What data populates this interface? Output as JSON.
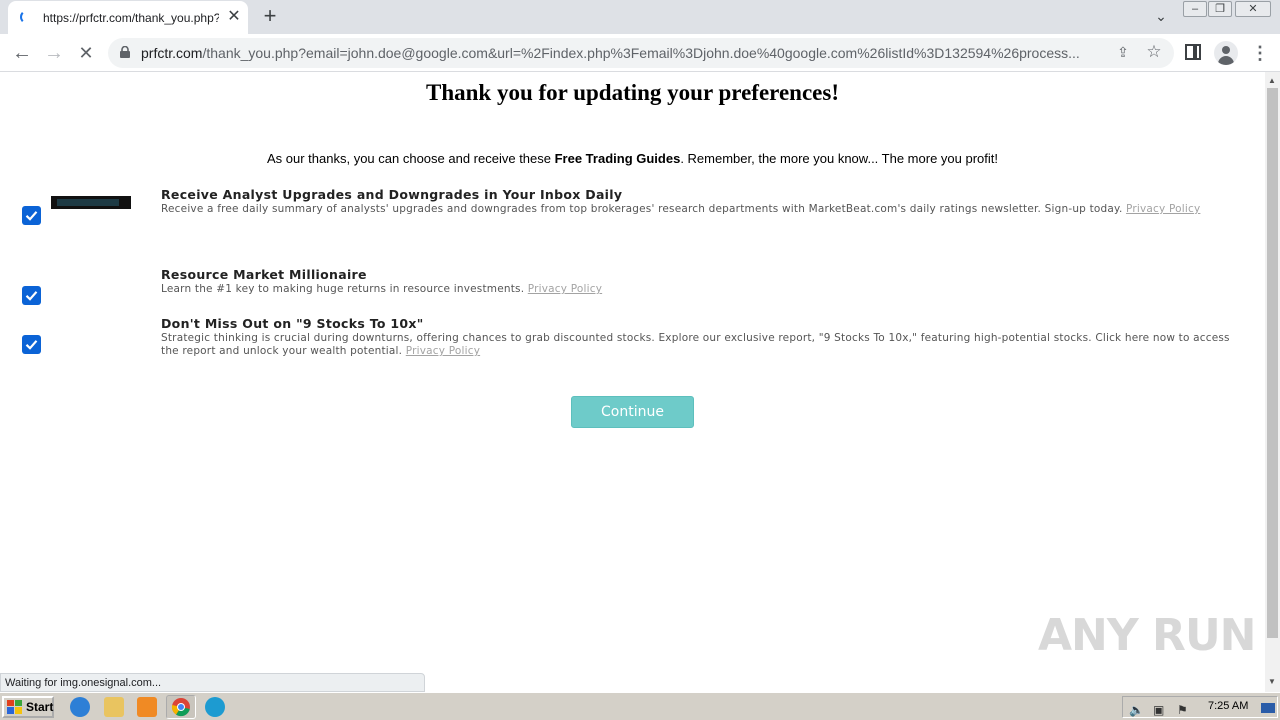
{
  "browser": {
    "tab_title": "https://prfctr.com/thank_you.php?e",
    "tab_close": "✕",
    "new_tab": "+",
    "tab_search_icon": "chevron-down-icon",
    "window_min": "‒",
    "window_max": "❐",
    "window_close": "✕",
    "url_host": "prfctr.com",
    "url_rest": "/thank_you.php?email=john.doe@google.com&url=%2Findex.php%3Femail%3Djohn.doe%40google.com%26listId%3D132594%26process..."
  },
  "page": {
    "title": "Thank you for updating your preferences!",
    "thanks_prefix": "As our thanks, you can choose and receive these ",
    "thanks_bold": "Free Trading Guides",
    "thanks_suffix": ". Remember, the more you know... The more you profit!",
    "offers": [
      {
        "title": "Receive Analyst Upgrades and Downgrades in Your Inbox Daily",
        "description": "Receive a free daily summary of analysts' upgrades and downgrades from top brokerages' research departments with MarketBeat.com's daily ratings newsletter. Sign-up today.",
        "privacy_label": "Privacy Policy",
        "checked": true
      },
      {
        "title": "Resource Market Millionaire",
        "description": "Learn the #1 key to making huge returns in resource investments.",
        "privacy_label": "Privacy Policy",
        "checked": true
      },
      {
        "title": "Don't Miss Out on \"9 Stocks To 10x\"",
        "description": "Strategic thinking is crucial during downturns, offering chances to grab discounted stocks. Explore our exclusive report, \"9 Stocks To 10x,\" featuring high-potential stocks. Click here now to access the report and unlock your wealth potential.",
        "privacy_label": "Privacy Policy",
        "checked": true
      }
    ],
    "continue_label": "Continue",
    "watermark": "ANY RUN"
  },
  "status": {
    "text": "Waiting for img.onesignal.com..."
  },
  "taskbar": {
    "start_label": "Start",
    "clock": "7:25 AM"
  },
  "colors": {
    "accent": "#0b63d6",
    "button": "#6ecbc9"
  }
}
